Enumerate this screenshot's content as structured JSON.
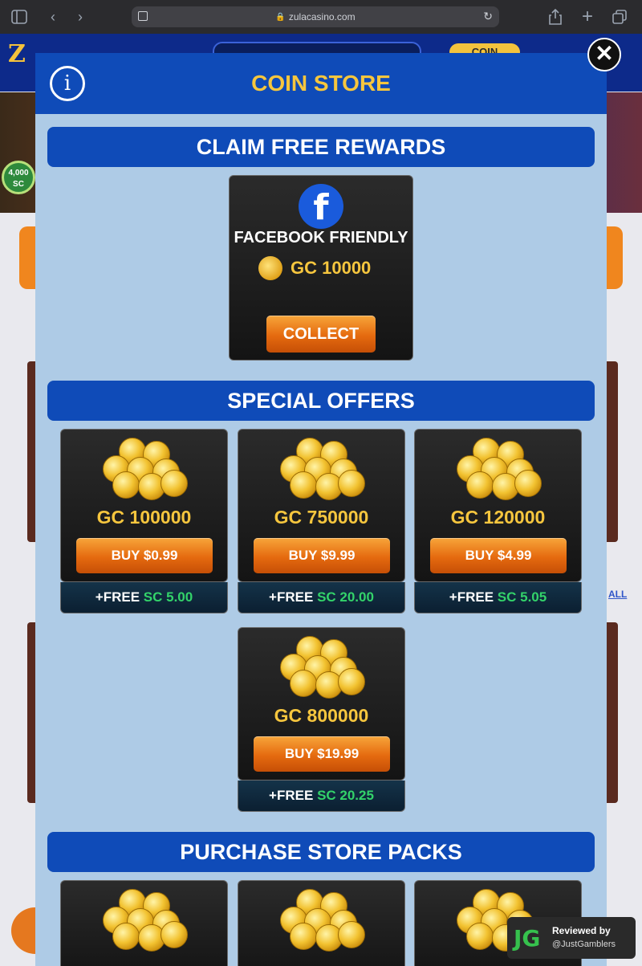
{
  "browser": {
    "url": "zulacasino.com",
    "icons": [
      "sidebar-icon",
      "back-icon",
      "forward-icon",
      "share-icon",
      "new-tab-icon",
      "tabs-icon"
    ]
  },
  "site": {
    "coin_button_label": "COIN",
    "badge_amount": "4,000",
    "badge_unit": "SC",
    "view_all_label": "ALL"
  },
  "modal": {
    "title": "COIN STORE",
    "close_icon": "close-icon",
    "info_icon": "info-icon"
  },
  "claim": {
    "section_title": "CLAIM FREE REWARDS",
    "card_title": "FACEBOOK FRIENDLY",
    "amount": "GC 10000",
    "button_label": "COLLECT"
  },
  "special": {
    "section_title": "SPECIAL OFFERS",
    "offers": [
      {
        "gc": "GC 100000",
        "price": "BUY $0.99",
        "free_prefix": "+FREE",
        "free_sc": "SC 5.00"
      },
      {
        "gc": "GC 750000",
        "price": "BUY $9.99",
        "free_prefix": "+FREE",
        "free_sc": "SC 20.00"
      },
      {
        "gc": "GC 120000",
        "price": "BUY $4.99",
        "free_prefix": "+FREE",
        "free_sc": "SC 5.05"
      },
      {
        "gc": "GC 800000",
        "price": "BUY $19.99",
        "free_prefix": "+FREE",
        "free_sc": "SC 20.25"
      }
    ]
  },
  "packs": {
    "section_title": "PURCHASE STORE PACKS"
  },
  "watermark": {
    "logo": "JG",
    "line1": "Reviewed by",
    "line2": "@JustGamblers"
  },
  "colors": {
    "modal_bg": "#aecbe6",
    "header_blue": "#0f4bb8",
    "gold": "#f6c63e",
    "sc_green": "#33d36a",
    "button_orange": "#e56a0f"
  }
}
